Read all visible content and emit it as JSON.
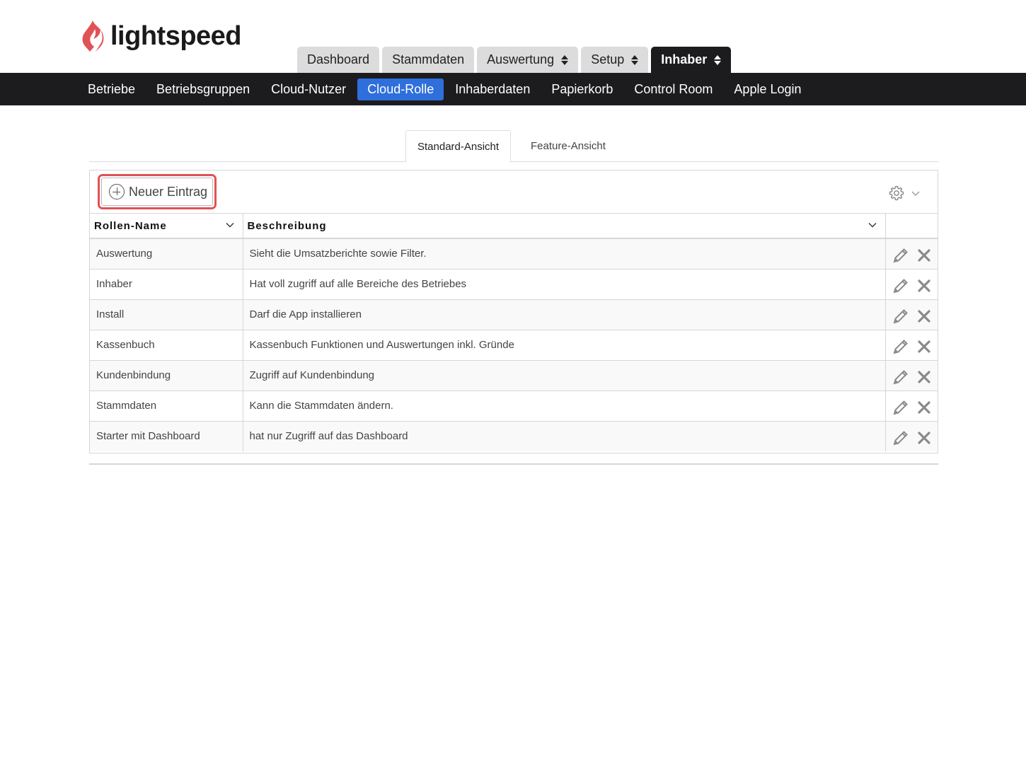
{
  "brand": {
    "name": "lightspeed",
    "color": "#e05255"
  },
  "main_tabs": [
    {
      "label": "Dashboard",
      "dropdown": false,
      "active": false
    },
    {
      "label": "Stammdaten",
      "dropdown": false,
      "active": false
    },
    {
      "label": "Auswertung",
      "dropdown": true,
      "active": false
    },
    {
      "label": "Setup",
      "dropdown": true,
      "active": false
    },
    {
      "label": "Inhaber",
      "dropdown": true,
      "active": true
    }
  ],
  "subnav": {
    "items": [
      "Betriebe",
      "Betriebsgruppen",
      "Cloud-Nutzer",
      "Cloud-Rolle",
      "Inhaberdaten",
      "Papierkorb",
      "Control Room",
      "Apple Login"
    ],
    "active": "Cloud-Rolle",
    "active_color": "#2f6fdb"
  },
  "view_tabs": {
    "standard": "Standard-Ansicht",
    "feature": "Feature-Ansicht"
  },
  "toolbar": {
    "new_label": "Neuer Eintrag",
    "settings_icon": "gear-icon"
  },
  "table": {
    "columns": [
      "Rollen-Name",
      "Beschreibung"
    ],
    "rows": [
      {
        "name": "Auswertung",
        "description": "Sieht die Umsatzberichte sowie Filter."
      },
      {
        "name": "Inhaber",
        "description": "Hat voll zugriff auf alle Bereiche des Betriebes"
      },
      {
        "name": "Install",
        "description": "Darf die App installieren"
      },
      {
        "name": "Kassenbuch",
        "description": "Kassenbuch Funktionen und Auswertungen inkl. Gründe"
      },
      {
        "name": "Kundenbindung",
        "description": "Zugriff auf Kundenbindung"
      },
      {
        "name": "Stammdaten",
        "description": "Kann die Stammdaten ändern."
      },
      {
        "name": "Starter mit Dashboard",
        "description": "hat nur Zugriff auf das Dashboard"
      }
    ]
  }
}
